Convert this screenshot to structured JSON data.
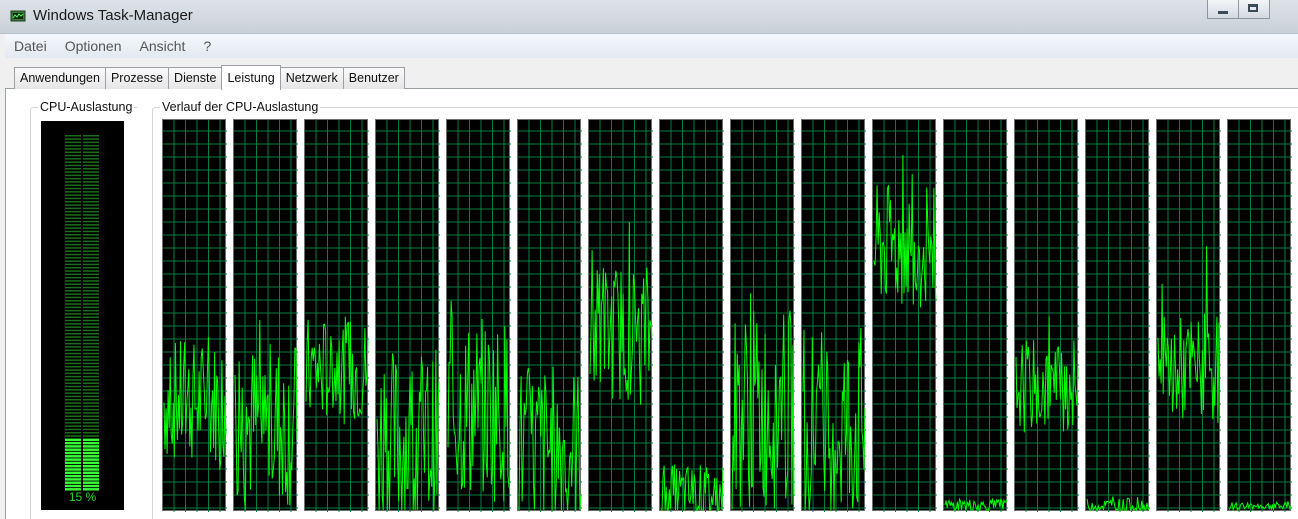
{
  "window": {
    "title": "Windows Task-Manager",
    "app_icon": "task-manager-icon",
    "controls": [
      "minimize-icon",
      "maximize-icon"
    ]
  },
  "menu": {
    "items": [
      "Datei",
      "Optionen",
      "Ansicht",
      "?"
    ]
  },
  "tabs": [
    {
      "label": "Anwendungen",
      "active": false
    },
    {
      "label": "Prozesse",
      "active": false
    },
    {
      "label": "Dienste",
      "active": false
    },
    {
      "label": "Leistung",
      "active": true
    },
    {
      "label": "Netzwerk",
      "active": false
    },
    {
      "label": "Benutzer",
      "active": false
    }
  ],
  "cpu_usage": {
    "label": "CPU-Auslastung",
    "value_text": "15 %",
    "percent": 15
  },
  "cpu_history": {
    "label": "Verlauf der CPU-Auslastung",
    "grid_color": "#008040",
    "line_color": "#00ff00",
    "cores": [
      {
        "level": 28,
        "variance": 16
      },
      {
        "level": 22,
        "variance": 22
      },
      {
        "level": 36,
        "variance": 14
      },
      {
        "level": 18,
        "variance": 24
      },
      {
        "level": 26,
        "variance": 24
      },
      {
        "level": 16,
        "variance": 22
      },
      {
        "level": 46,
        "variance": 18
      },
      {
        "level": 4,
        "variance": 8
      },
      {
        "level": 26,
        "variance": 26
      },
      {
        "level": 22,
        "variance": 26
      },
      {
        "level": 68,
        "variance": 16
      },
      {
        "level": 1,
        "variance": 2
      },
      {
        "level": 32,
        "variance": 12
      },
      {
        "level": 1,
        "variance": 2
      },
      {
        "level": 36,
        "variance": 14
      },
      {
        "level": 1,
        "variance": 1
      }
    ]
  }
}
